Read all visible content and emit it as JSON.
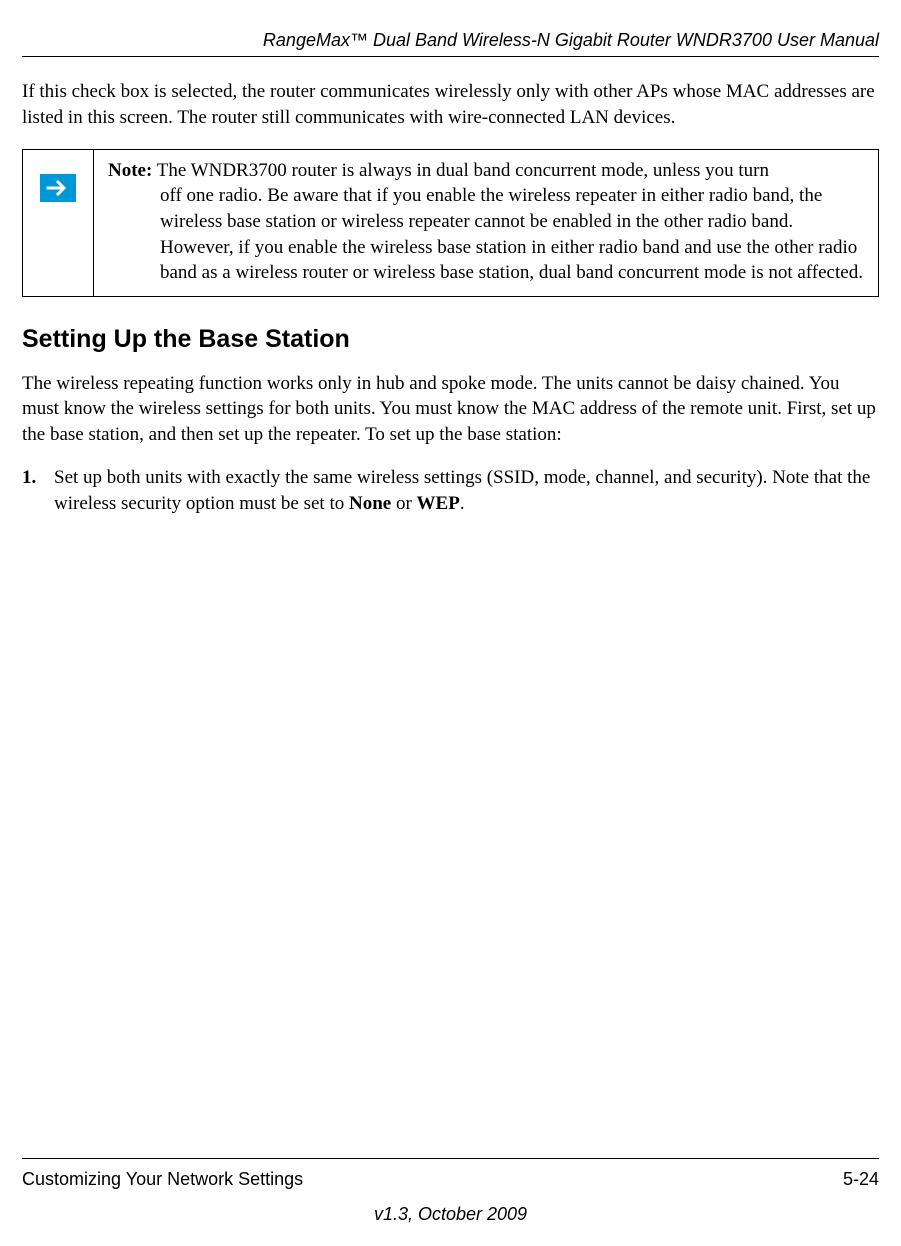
{
  "header": {
    "title": "RangeMax™ Dual Band Wireless-N Gigabit Router WNDR3700 User Manual"
  },
  "body": {
    "intro_paragraph": "If this check box is selected, the router communicates wirelessly only with other APs whose MAC addresses are listed in this screen. The router still communicates with wire-connected LAN devices.",
    "note": {
      "label": "Note:",
      "first_line": " The WNDR3700 router is always in dual band concurrent mode, unless you turn",
      "rest": "off one radio. Be aware that if you enable the wireless repeater in either radio band, the wireless base station or wireless repeater cannot be enabled in the other radio band. However, if you enable the wireless base station in either radio band and use the other radio band as a wireless router or wireless base station, dual band concurrent mode is not affected."
    },
    "section_heading": "Setting Up the Base Station",
    "section_paragraph": "The wireless repeating function works only in hub and spoke mode. The units cannot be daisy chained. You must know the wireless settings for both units. You must know the MAC address of the remote unit. First, set up the base station, and then set up the repeater. To set up the base station:",
    "steps": [
      {
        "num": "1.",
        "text_before": "Set up both units with exactly the same wireless settings (SSID, mode, channel, and security). Note that the wireless security option must be set to ",
        "bold1": "None",
        "middle": " or ",
        "bold2": "WEP",
        "after": "."
      }
    ]
  },
  "footer": {
    "left": "Customizing Your Network Settings",
    "right": "5-24",
    "version": "v1.3, October 2009"
  }
}
